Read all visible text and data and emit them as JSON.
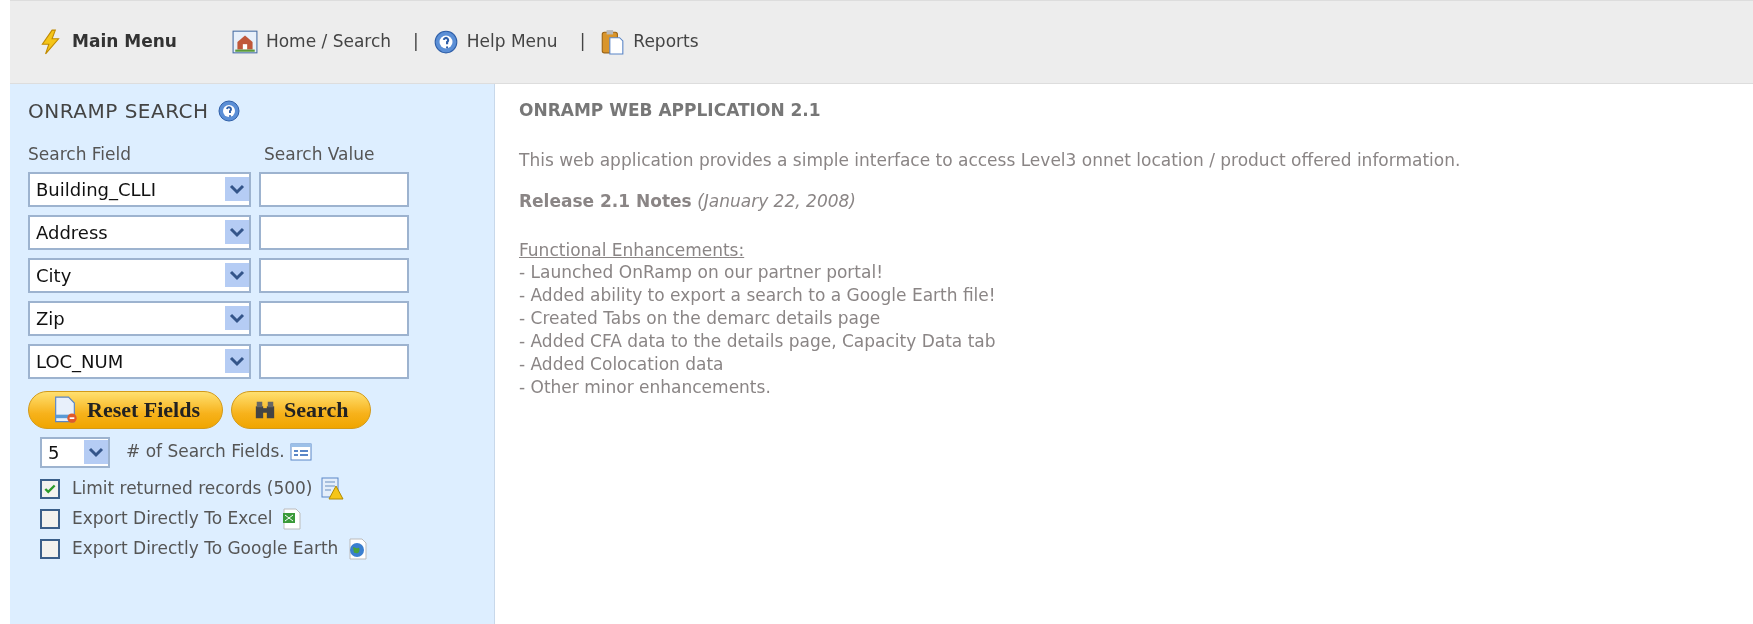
{
  "nav": {
    "brand": "Main Menu",
    "links": [
      {
        "label": "Home / Search",
        "separator": "|"
      },
      {
        "label": "Help Menu",
        "separator": "|"
      },
      {
        "label": "Reports"
      }
    ]
  },
  "search": {
    "title": "ONRAMP SEARCH",
    "columns": [
      "Search Field",
      "Search Value"
    ],
    "rows": [
      {
        "field": "Building_CLLI"
      },
      {
        "field": "Address"
      },
      {
        "field": "City"
      },
      {
        "field": "Zip"
      },
      {
        "field": "LOC_NUM"
      }
    ],
    "buttons": [
      "Reset Fields",
      "Search"
    ],
    "count": {
      "value": "5",
      "label": "# of Search Fields."
    },
    "options": [
      {
        "label": "Limit returned records (500)",
        "checked": true
      },
      {
        "label": "Export Directly To Excel",
        "checked": false
      },
      {
        "label": "Export Directly To Google Earth",
        "checked": false
      }
    ]
  },
  "main": {
    "title": "ONRAMP WEB APPLICATION 2.1",
    "intro": "This web application provides a simple interface to access Level3 onnet location / product offered information.",
    "release": "**Release 2.1 Notes** *(January 22, 2008)*",
    "heading": "Functional Enhancements:",
    "items": [
      "- Launched OnRamp on our partner portal!",
      "- Added ability to export a search to a Google Earth file!",
      "- Created Tabs on the demarc details page",
      "- Added CFA data to the details page, Capacity Data tab",
      "- Added Colocation data",
      "- Other minor enhancements."
    ]
  }
}
